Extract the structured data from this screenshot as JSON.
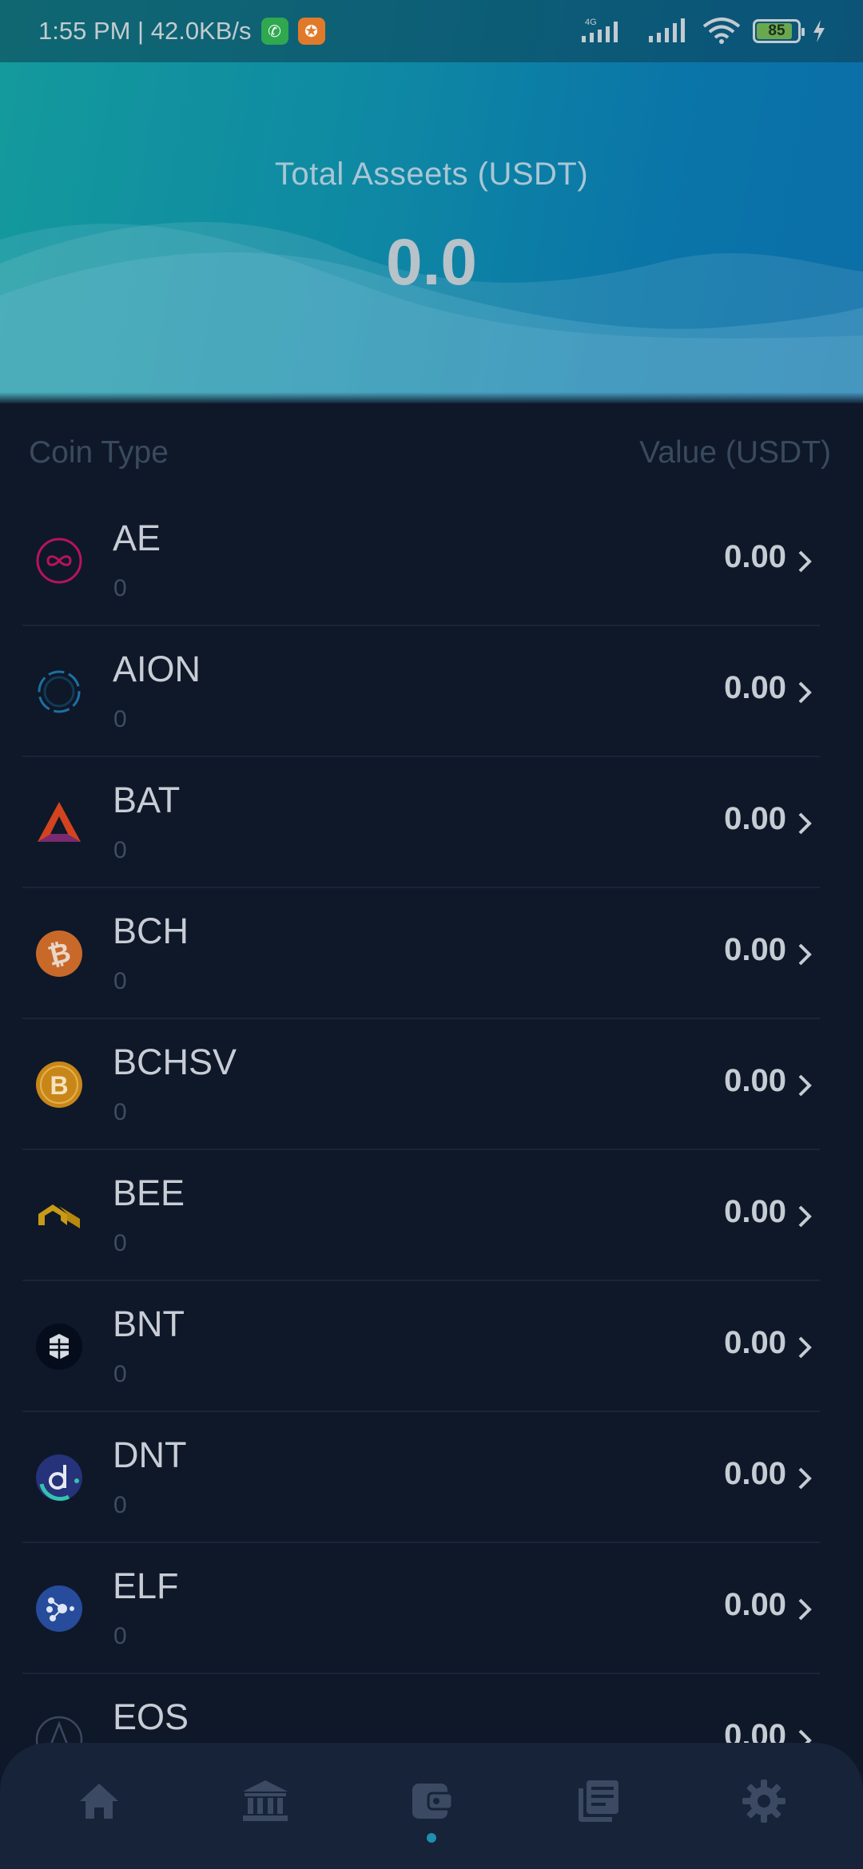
{
  "status_bar": {
    "time_speed": "1:55 PM | 42.0KB/s",
    "network": "4G",
    "battery": "85"
  },
  "header": {
    "total_label": "Total Asseets (USDT)",
    "total_value": "0.0"
  },
  "columns": {
    "coin_type": "Coin Type",
    "value": "Value (USDT)"
  },
  "coins": [
    {
      "symbol": "AE",
      "amount": "0",
      "value": "0.00",
      "icon": "aeternity-icon",
      "color": "#c2185b"
    },
    {
      "symbol": "AION",
      "amount": "0",
      "value": "0.00",
      "icon": "aion-icon",
      "color": "#1e88c8"
    },
    {
      "symbol": "BAT",
      "amount": "0",
      "value": "0.00",
      "icon": "bat-icon",
      "color": "#e8421c"
    },
    {
      "symbol": "BCH",
      "amount": "0",
      "value": "0.00",
      "icon": "bch-icon",
      "color": "#e07b2c"
    },
    {
      "symbol": "BCHSV",
      "amount": "0",
      "value": "0.00",
      "icon": "bchsv-icon",
      "color": "#e8a319"
    },
    {
      "symbol": "BEE",
      "amount": "0",
      "value": "0.00",
      "icon": "bee-icon",
      "color": "#d8a21c"
    },
    {
      "symbol": "BNT",
      "amount": "0",
      "value": "0.00",
      "icon": "bancor-icon",
      "color": "#000d2b"
    },
    {
      "symbol": "DNT",
      "amount": "0",
      "value": "0.00",
      "icon": "district0x-icon",
      "color": "#2c398f"
    },
    {
      "symbol": "ELF",
      "amount": "0",
      "value": "0.00",
      "icon": "aelf-icon",
      "color": "#2b5ebd"
    },
    {
      "symbol": "EOS",
      "amount": "",
      "value": "0.00",
      "icon": "eos-icon",
      "color": "#000000"
    }
  ],
  "nav": [
    {
      "icon": "home-icon"
    },
    {
      "icon": "bank-icon"
    },
    {
      "icon": "wallet-icon",
      "active": true
    },
    {
      "icon": "news-icon"
    },
    {
      "icon": "settings-icon"
    }
  ],
  "colors": {
    "background": "#0e1829",
    "header_accent": "#0f8aa3",
    "active_dot": "#1f8fb0"
  }
}
